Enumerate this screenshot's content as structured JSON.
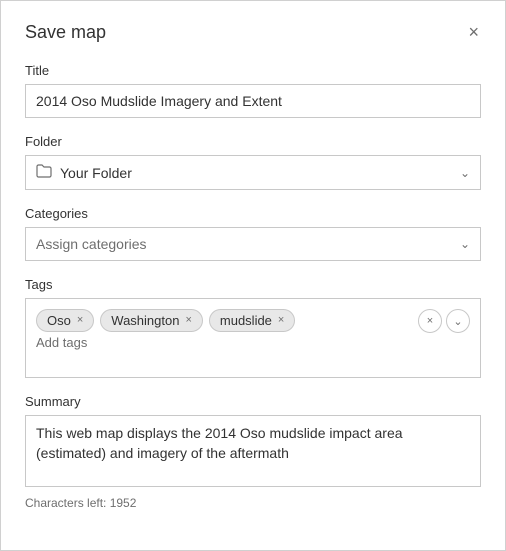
{
  "dialog": {
    "title": "Save map",
    "close_label": "×"
  },
  "title_field": {
    "label": "Title",
    "value": "2014 Oso Mudslide Imagery and Extent"
  },
  "folder_field": {
    "label": "Folder",
    "value": "Your Folder",
    "folder_icon": "🗂"
  },
  "categories_field": {
    "label": "Categories",
    "placeholder": "Assign categories"
  },
  "tags_field": {
    "label": "Tags",
    "tags": [
      {
        "id": "tag-oso",
        "label": "Oso"
      },
      {
        "id": "tag-washington",
        "label": "Washington"
      },
      {
        "id": "tag-mudslide",
        "label": "mudslide"
      }
    ],
    "add_placeholder": "Add tags",
    "clear_label": "×",
    "expand_label": "⌄"
  },
  "summary_field": {
    "label": "Summary",
    "value": "This web map displays the 2014 Oso mudslide impact area (estimated) and imagery of the aftermath",
    "chars_left_label": "Characters left: 1952"
  }
}
